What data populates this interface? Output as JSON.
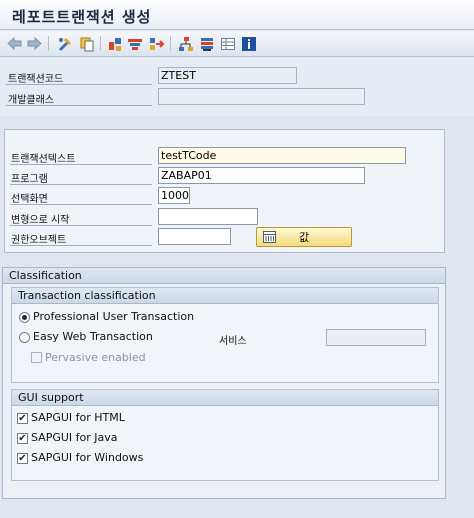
{
  "title": "레포트트랜잭션 생성",
  "toolbar": {
    "icons": [
      "back-arrow-icon",
      "forward-arrow-icon",
      "display-change-icon",
      "copy-icon",
      "check-icon",
      "generate-icon",
      "where-used-icon",
      "hierarchy-icon",
      "layout-icon",
      "table-icon",
      "info-icon"
    ]
  },
  "header": {
    "tcode_label": "트랜잭션코드",
    "tcode_value": "ZTEST",
    "devclass_label": "개발클래스",
    "devclass_value": ""
  },
  "main": {
    "text_label": "트랜잭션텍스트",
    "text_value": "testTCode",
    "program_label": "프로그램",
    "program_value": "ZABAP01",
    "screen_label": "선택화면",
    "screen_value": "1000",
    "variant_label": "변형으로 시작",
    "variant_value": "",
    "authobj_label": "권한오브젝트",
    "authobj_value": "",
    "value_button": "값"
  },
  "classification": {
    "title": "Classification",
    "tc_title": "Transaction classification",
    "opt_professional": "Professional User Transaction",
    "opt_easyweb": "Easy Web Transaction",
    "service_label": "서비스",
    "service_value": "",
    "opt_pervasive": "Pervasive enabled",
    "gui_title": "GUI support",
    "gui_html": "SAPGUI for HTML",
    "gui_java": "SAPGUI for Java",
    "gui_windows": "SAPGUI for Windows"
  }
}
